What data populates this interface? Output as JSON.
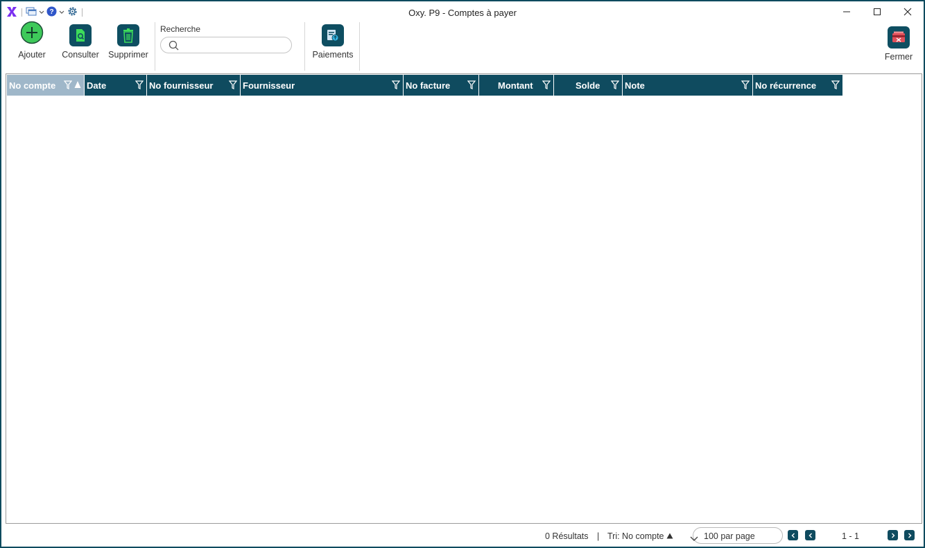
{
  "window": {
    "title": "Oxy. P9 - Comptes à payer",
    "controls": [
      "minimize-icon",
      "maximize-icon",
      "close-icon"
    ]
  },
  "quick_access": {
    "icons": [
      "oxy-logo-icon",
      "windows-icon",
      "help-icon",
      "settings-icon"
    ]
  },
  "toolbar": {
    "add_label": "Ajouter",
    "view_label": "Consulter",
    "delete_label": "Supprimer",
    "search_label": "Recherche",
    "search_value": "",
    "payments_label": "Paiements",
    "close_label": "Fermer"
  },
  "grid": {
    "columns": [
      {
        "label": "No compte",
        "sorted": "asc"
      },
      {
        "label": "Date"
      },
      {
        "label": "No fournisseur"
      },
      {
        "label": "Fournisseur"
      },
      {
        "label": "No facture"
      },
      {
        "label": "Montant"
      },
      {
        "label": "Solde"
      },
      {
        "label": "Note"
      },
      {
        "label": "No récurrence"
      }
    ],
    "rows": []
  },
  "footer": {
    "results": "0 Résultats",
    "separator": "|",
    "sort": "Tri: No compte",
    "per_page": "100 par page",
    "page_range": "1 - 1"
  },
  "colors": {
    "accent": "#0f4b5f",
    "sorted_header": "#9fb7c9",
    "add_green": "#3ec95a",
    "delete_green": "#3ddc5a",
    "close_red": "#e0505a",
    "logo_purple": "#7a2ff0"
  }
}
